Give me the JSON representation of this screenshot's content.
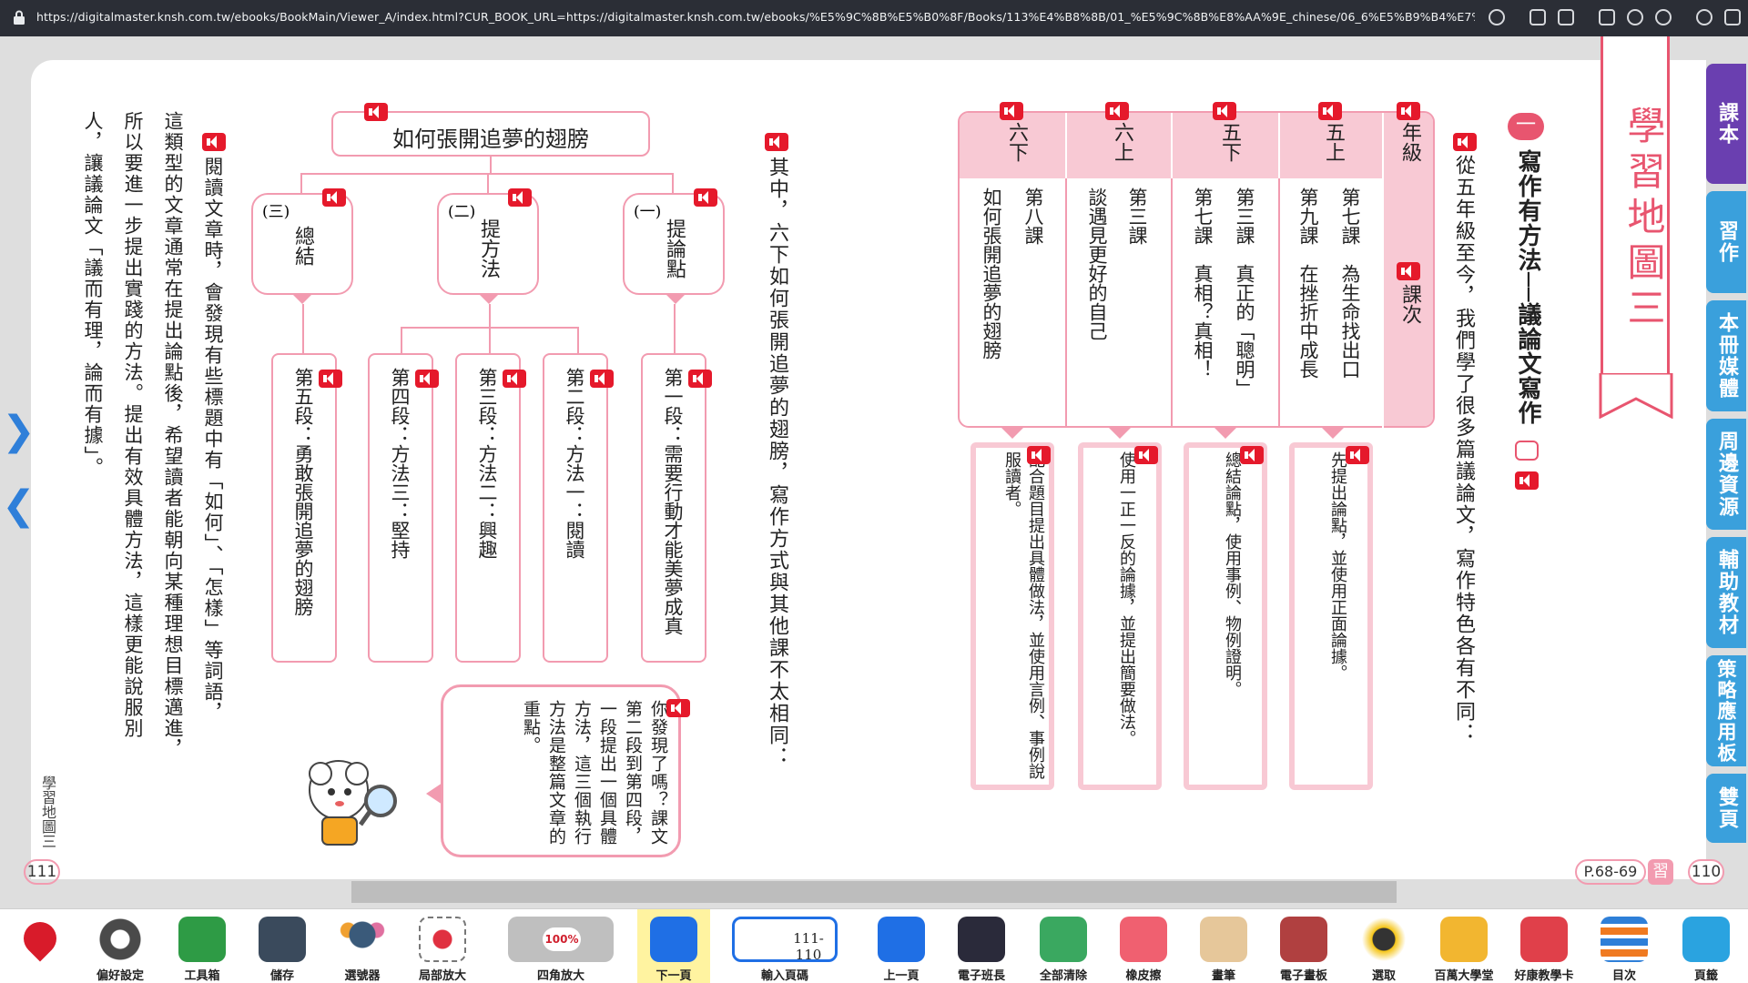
{
  "browser": {
    "url": "https://digitalmaster.knsh.com.tw/ebooks/BookMain/Viewer_A/index.html?CUR_BOOK_URL=https://digitalmaster.knsh.com.tw/ebooks/%E5%9C%8B%E5%B0%8F/Books/113%E4%B8%8B/01_%E5%9C%8B%E8%AA%9E_chinese/06_6%E5%B9%B4%E7%B4%9A/01_%E7%B6%B2%E9%A0%81%E9%9B..."
  },
  "left_page": {
    "title_box": "如何張開追夢的翅膀",
    "branches": [
      {
        "label": "(一)",
        "text": "提論點"
      },
      {
        "label": "(二)",
        "text": "提方法"
      },
      {
        "label": "(三)",
        "text": "總結"
      }
    ],
    "paragraphs": [
      "第一段：需要行動才能美夢成真",
      "第二段：方法一：閱讀",
      "第三段：方法二：興趣",
      "第四段：方法三：堅持",
      "第五段：勇敢張開追夢的翅膀"
    ],
    "intro_text": "其中，六下如何張開追夢的翅膀，寫作方式與其他課不太相同：",
    "intro_underlined": "如何張開追夢的翅膀",
    "body_columns": [
      "閱讀文章時，會發現有些標題中有「如何」、「怎樣」等詞語，",
      "這類型的文章通常在提出論點後，希望讀者能朝向某種理想目標邁進，",
      "所以要進一步提出實踐的方法。提出有效具體方法，這樣更能說服別",
      "人，讓議論文「議而有理，論而有據」。"
    ],
    "bubble_text": "你發現了嗎？課文第二段到第四段，一段提出一個具體方法，這三個執行方法是整篇文章的重點。",
    "side_label": "學習地圖三",
    "page_number": "111"
  },
  "right_page": {
    "banner": "學習地圖三",
    "heading_number": "一",
    "heading": "寫作有方法──議論文寫作",
    "intro": "從五年級至今，我們學了很多篇議論文，寫作特色各有不同：",
    "table": {
      "header_grade": "年級",
      "header_lesson": "課次",
      "columns": [
        {
          "grade": "五上",
          "lessons": [
            "第七課　為生命找出口",
            "第九課　在挫折中成長"
          ],
          "note": "先提出論點，並使用正面論據。"
        },
        {
          "grade": "五下",
          "lessons": [
            "第三課　真正的「聰明」",
            "第七課　真相？真相！"
          ],
          "note": "總結論點，使用事例、物例證明。"
        },
        {
          "grade": "六上",
          "lessons": [
            "第三課",
            "談遇見更好的自己"
          ],
          "note": "使用一正一反的論據，並提出簡要做法。"
        },
        {
          "grade": "六下",
          "lessons": [
            "第八課",
            "如何張開追夢的翅膀"
          ],
          "note": "配合題目提出具體做法，並使用言例、事例說服讀者。"
        }
      ]
    },
    "page_ref": "P.68-69",
    "page_ref_badge": "習",
    "page_number": "110"
  },
  "side_tabs": [
    "課本",
    "習作",
    "本冊媒體",
    "周邊資源",
    "輔助教材",
    "策略應用板",
    "雙頁"
  ],
  "toolbar": [
    {
      "label": "偏好設定",
      "icon": "gear-icon"
    },
    {
      "label": "工具箱",
      "icon": "toolbox-icon"
    },
    {
      "label": "儲存",
      "icon": "save-icon"
    },
    {
      "label": "選號器",
      "icon": "number-picker-icon"
    },
    {
      "label": "局部放大",
      "icon": "zoom-in-icon"
    },
    {
      "label": "四角放大",
      "icon": "zoom-percent-icon",
      "badge": "100%"
    },
    {
      "label": "下一頁",
      "icon": "next-page-icon"
    },
    {
      "label": "輸入頁碼",
      "icon": "page-input-icon",
      "badge": "111-110"
    },
    {
      "label": "上一頁",
      "icon": "prev-page-icon"
    },
    {
      "label": "電子班長",
      "icon": "graduation-cap-icon"
    },
    {
      "label": "全部清除",
      "icon": "trash-icon"
    },
    {
      "label": "橡皮擦",
      "icon": "eraser-icon"
    },
    {
      "label": "畫筆",
      "icon": "palette-icon"
    },
    {
      "label": "電子畫板",
      "icon": "easel-icon"
    },
    {
      "label": "選取",
      "icon": "cursor-icon"
    },
    {
      "label": "百萬大學堂",
      "icon": "trophy-icon"
    },
    {
      "label": "好康教學卡",
      "icon": "cards-icon"
    },
    {
      "label": "目次",
      "icon": "toc-icon"
    },
    {
      "label": "頁籤",
      "icon": "bookmark-icon"
    }
  ],
  "colors": {
    "accent_pink": "#f29bb0",
    "pink_fill": "#f8c9d4",
    "banner_pink": "#e8556f",
    "speaker_red": "#e5192b",
    "tab_blue": "#3aa0dc",
    "tab_purple": "#6a3fb0"
  }
}
